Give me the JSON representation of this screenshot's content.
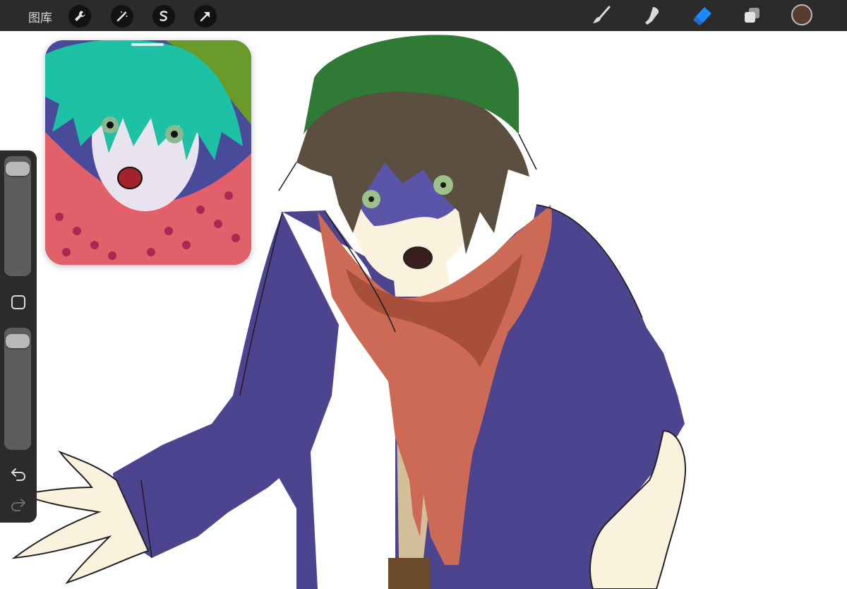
{
  "topbar": {
    "gallery_label": "图库",
    "left_tools": [
      "wrench-icon",
      "magic-wand-icon",
      "selection-icon",
      "transform-arrow-icon"
    ],
    "right_tools": [
      "brush-icon",
      "smudge-icon",
      "eraser-icon",
      "layers-icon"
    ],
    "active_tool": "eraser",
    "active_color": "#5a3b2e",
    "active_tool_color": "#1e88ff"
  },
  "sidebar": {
    "brush_size_level": 0.04,
    "opacity_level": 0.05,
    "icons": [
      "modify-square-icon",
      "undo-icon",
      "redo-icon"
    ]
  },
  "reference_window": {
    "content": "reference image"
  },
  "canvas": {
    "colors": {
      "jacket": "#4d448f",
      "scarf": "#cc6a55",
      "scarf_shadow": "#a34c38",
      "hat": "#2f7a35",
      "hair": "#5b4f3f",
      "skin": "#fbf2de",
      "shirt": "#d3bf9a",
      "eyes": "#9bc28a",
      "ref_hair": "#1dc2a5",
      "ref_scarf": "#e2606a"
    }
  }
}
